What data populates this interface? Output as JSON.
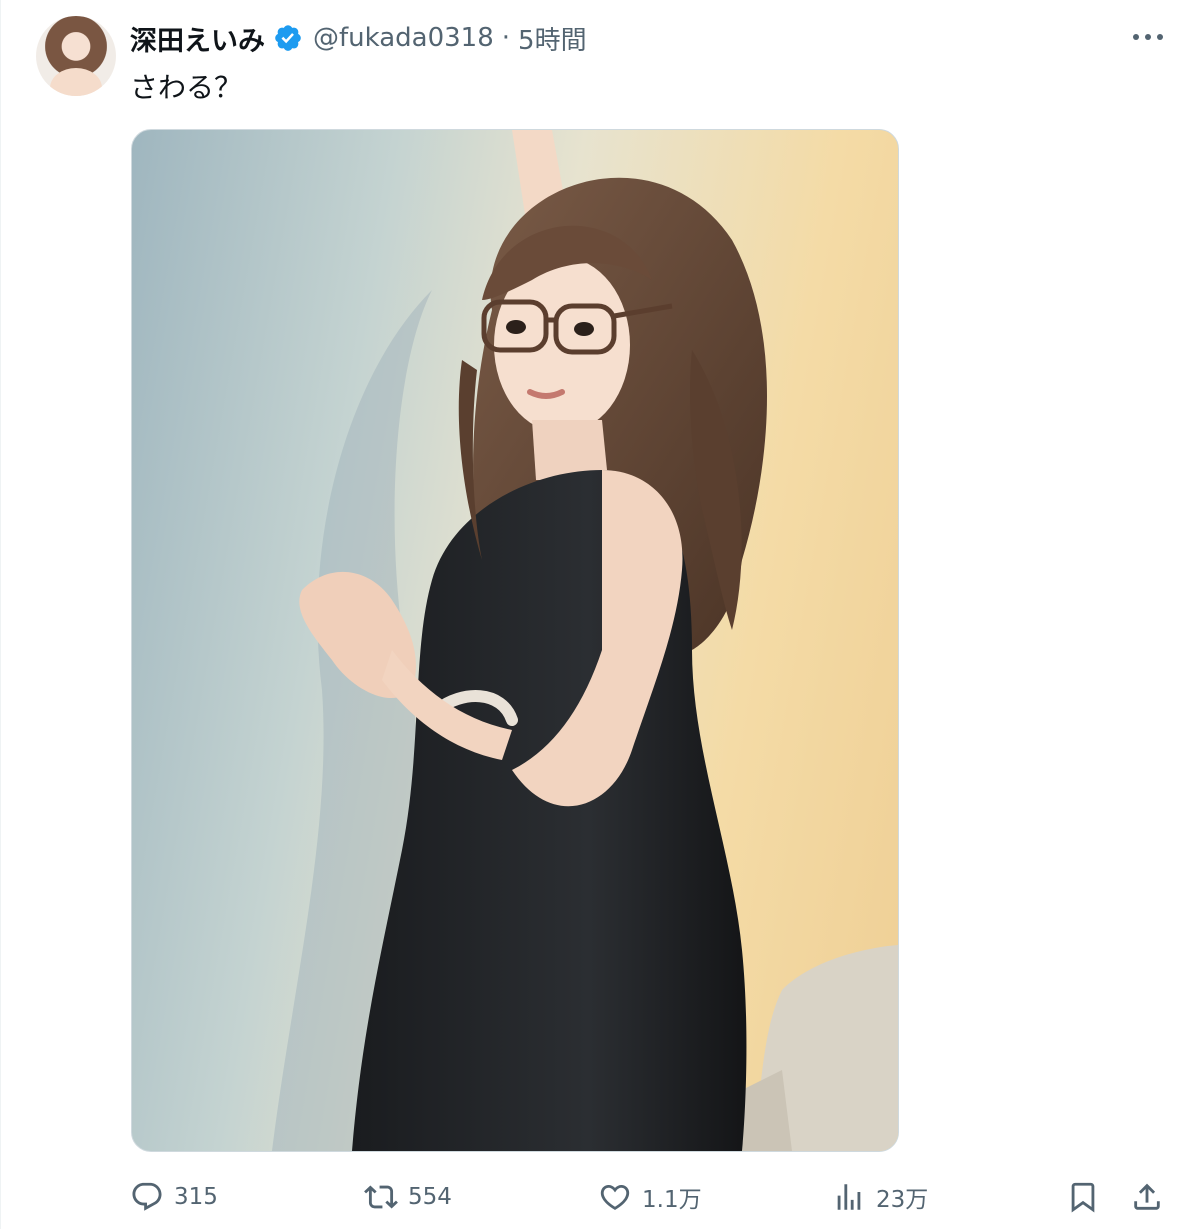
{
  "tweet": {
    "author": {
      "display_name": "深田えいみ",
      "handle": "@fukada0318",
      "verified": true,
      "verified_color": "#1d9bf0"
    },
    "separator": "·",
    "time": "5時間",
    "text": "さわる？",
    "media": {
      "type": "photo"
    },
    "actions": {
      "reply": {
        "icon": "reply-icon",
        "count": "315"
      },
      "retweet": {
        "icon": "retweet-icon",
        "count": "554"
      },
      "like": {
        "icon": "heart-icon",
        "count": "1.1万"
      },
      "views": {
        "icon": "analytics-icon",
        "count": "23万"
      },
      "bookmark": {
        "icon": "bookmark-icon"
      },
      "share": {
        "icon": "share-icon"
      }
    },
    "more_icon": "more-icon"
  }
}
